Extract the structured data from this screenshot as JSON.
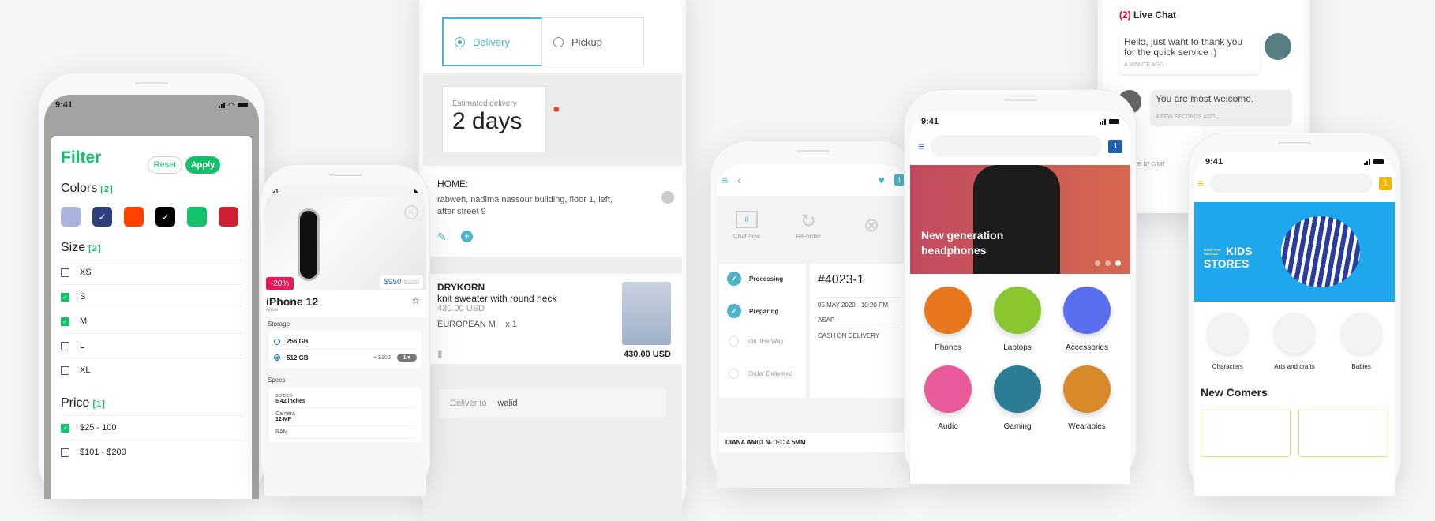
{
  "status_time": "9:41",
  "filter_screen": {
    "title": "Filter",
    "reset_label": "Reset",
    "apply_label": "Apply",
    "colors_label": "Colors",
    "colors_count": "[2]",
    "swatches": [
      {
        "color": "#aab4dd",
        "checked": false
      },
      {
        "color": "#2f3f7c",
        "checked": true
      },
      {
        "color": "#ff4000",
        "checked": false
      },
      {
        "color": "#000000",
        "checked": true
      },
      {
        "color": "#13c16a",
        "checked": false
      },
      {
        "color": "#cc2233",
        "checked": false
      }
    ],
    "size_label": "Size",
    "size_count": "[2]",
    "sizes": [
      {
        "label": "XS",
        "checked": false
      },
      {
        "label": "S",
        "checked": true
      },
      {
        "label": "M",
        "checked": true
      },
      {
        "label": "L",
        "checked": false
      },
      {
        "label": "XL",
        "checked": false
      }
    ],
    "price_label": "Price",
    "price_count": "[1]",
    "prices": [
      {
        "label": "$25 - 100",
        "checked": true
      },
      {
        "label": "$101 - $200",
        "checked": false
      }
    ]
  },
  "product_screen": {
    "discount": "-20%",
    "price": "$950",
    "old_price": "$1220",
    "name": "iPhone 12",
    "brand": "Apple",
    "storage_label": "Storage",
    "storage_options": [
      {
        "label": "256 GB",
        "selected": false,
        "extra": ""
      },
      {
        "label": "512 GB",
        "selected": true,
        "extra": "+ $100"
      }
    ],
    "qty": "1",
    "specs_label": "Specs",
    "specs": [
      {
        "key": "screen",
        "value": "5.42 inches"
      },
      {
        "key": "Camera",
        "value": "12 MP"
      },
      {
        "key": "RAM",
        "value": ""
      }
    ]
  },
  "delivery_screen": {
    "delivery_label": "Delivery",
    "pickup_label": "Pickup",
    "estimate_label": "Estimated delivery",
    "estimate_value": "2 days",
    "address_title": "HOME:",
    "address_text": "rabweh, nadima nassour building, floor 1, left, after street 9",
    "item_brand": "DRYKORN",
    "item_name": "knit sweater with round neck",
    "item_price": "430.00 USD",
    "item_size": "EUROPEAN M",
    "item_qty": "x 1",
    "item_total": "430.00 USD",
    "deliver_to_label": "Deliver to",
    "deliver_to_value": "walid"
  },
  "order_screen": {
    "chat_label": "Chat now",
    "chat_count": "0",
    "reorder_label": "Re-order",
    "steps": [
      {
        "label": "Processing",
        "done": true
      },
      {
        "label": "Preparing",
        "done": true
      },
      {
        "label": "On The Way",
        "done": false
      },
      {
        "label": "Order Delivered",
        "done": false
      }
    ],
    "order_id": "#4023-1",
    "order_date": "05 MAY 2020 - 10:20 PM",
    "order_time": "ASAP",
    "payment": "CASH ON DELIVERY",
    "next_item": "DIANA AM03 N-TEC 4.5MM",
    "cart_count": "1"
  },
  "electronics_screen": {
    "cart_count": "1",
    "banner_title": "New generation headphones",
    "categories": [
      {
        "label": "Phones",
        "color": "#e8761c"
      },
      {
        "label": "Laptops",
        "color": "#8ac630"
      },
      {
        "label": "Accessories",
        "color": "#5a6ef0"
      },
      {
        "label": "Audio",
        "color": "#e85a9a"
      },
      {
        "label": "Gaming",
        "color": "#2a7d94"
      },
      {
        "label": "Wearables",
        "color": "#d88a2a"
      }
    ]
  },
  "chat_screen": {
    "unread": "(2)",
    "title": "Live Chat",
    "messages": [
      {
        "text": "Hello, just want to thank you for the quick service :)",
        "time": "A MINUTE AGO"
      },
      {
        "text": "You are most welcome.",
        "time": "A FEW SECONDS AGO"
      }
    ],
    "input_placeholder": "here to chat"
  },
  "kids_screen": {
    "cart_count": "1",
    "banner_small": "MADE FOR AMAZING",
    "banner_big1": "KIDS",
    "banner_big2": "STORES",
    "categories": [
      "Characters",
      "Arts and crafts",
      "Babies"
    ],
    "section_title": "New Comers"
  }
}
